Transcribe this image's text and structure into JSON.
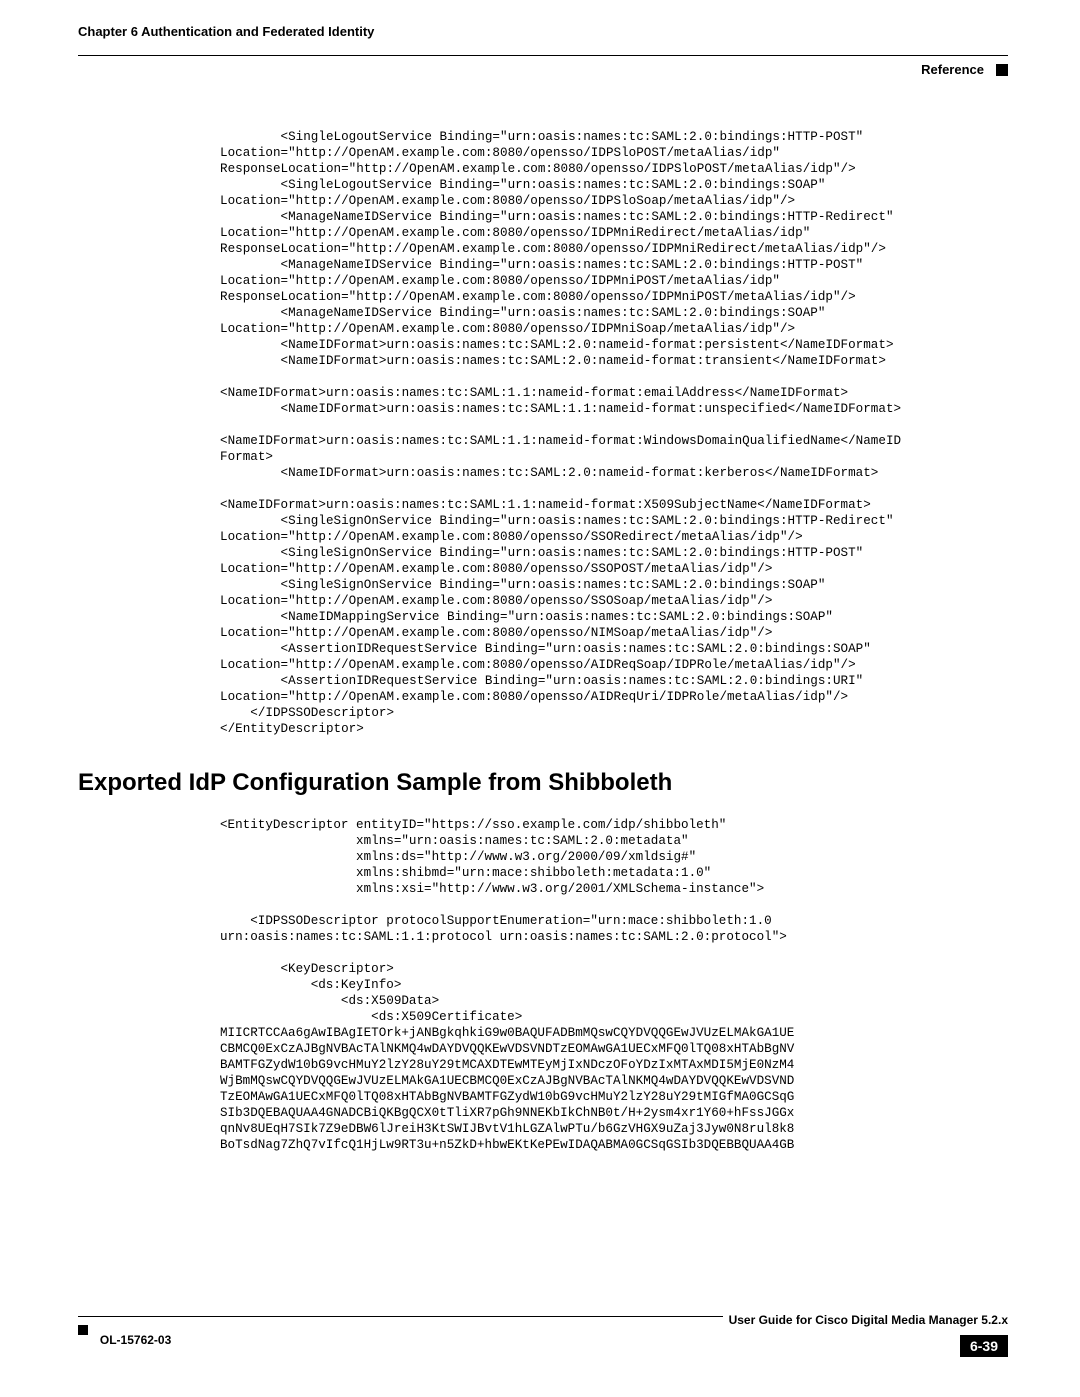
{
  "header": {
    "chapter": "Chapter 6    Authentication and Federated Identity",
    "reference": "Reference"
  },
  "code_block_1": "        <SingleLogoutService Binding=\"urn:oasis:names:tc:SAML:2.0:bindings:HTTP-POST\" \nLocation=\"http://OpenAM.example.com:8080/opensso/IDPSloPOST/metaAlias/idp\" \nResponseLocation=\"http://OpenAM.example.com:8080/opensso/IDPSloPOST/metaAlias/idp\"/>\n        <SingleLogoutService Binding=\"urn:oasis:names:tc:SAML:2.0:bindings:SOAP\" \nLocation=\"http://OpenAM.example.com:8080/opensso/IDPSloSoap/metaAlias/idp\"/>\n        <ManageNameIDService Binding=\"urn:oasis:names:tc:SAML:2.0:bindings:HTTP-Redirect\" \nLocation=\"http://OpenAM.example.com:8080/opensso/IDPMniRedirect/metaAlias/idp\" \nResponseLocation=\"http://OpenAM.example.com:8080/opensso/IDPMniRedirect/metaAlias/idp\"/>\n        <ManageNameIDService Binding=\"urn:oasis:names:tc:SAML:2.0:bindings:HTTP-POST\" \nLocation=\"http://OpenAM.example.com:8080/opensso/IDPMniPOST/metaAlias/idp\" \nResponseLocation=\"http://OpenAM.example.com:8080/opensso/IDPMniPOST/metaAlias/idp\"/>\n        <ManageNameIDService Binding=\"urn:oasis:names:tc:SAML:2.0:bindings:SOAP\" \nLocation=\"http://OpenAM.example.com:8080/opensso/IDPMniSoap/metaAlias/idp\"/>\n        <NameIDFormat>urn:oasis:names:tc:SAML:2.0:nameid-format:persistent</NameIDFormat>\n        <NameIDFormat>urn:oasis:names:tc:SAML:2.0:nameid-format:transient</NameIDFormat>\n        \n<NameIDFormat>urn:oasis:names:tc:SAML:1.1:nameid-format:emailAddress</NameIDFormat>\n        <NameIDFormat>urn:oasis:names:tc:SAML:1.1:nameid-format:unspecified</NameIDFormat>\n        \n<NameIDFormat>urn:oasis:names:tc:SAML:1.1:nameid-format:WindowsDomainQualifiedName</NameID\nFormat>\n        <NameIDFormat>urn:oasis:names:tc:SAML:2.0:nameid-format:kerberos</NameIDFormat>\n        \n<NameIDFormat>urn:oasis:names:tc:SAML:1.1:nameid-format:X509SubjectName</NameIDFormat>\n        <SingleSignOnService Binding=\"urn:oasis:names:tc:SAML:2.0:bindings:HTTP-Redirect\" \nLocation=\"http://OpenAM.example.com:8080/opensso/SSORedirect/metaAlias/idp\"/>\n        <SingleSignOnService Binding=\"urn:oasis:names:tc:SAML:2.0:bindings:HTTP-POST\" \nLocation=\"http://OpenAM.example.com:8080/opensso/SSOPOST/metaAlias/idp\"/>\n        <SingleSignOnService Binding=\"urn:oasis:names:tc:SAML:2.0:bindings:SOAP\" \nLocation=\"http://OpenAM.example.com:8080/opensso/SSOSoap/metaAlias/idp\"/>\n        <NameIDMappingService Binding=\"urn:oasis:names:tc:SAML:2.0:bindings:SOAP\" \nLocation=\"http://OpenAM.example.com:8080/opensso/NIMSoap/metaAlias/idp\"/>\n        <AssertionIDRequestService Binding=\"urn:oasis:names:tc:SAML:2.0:bindings:SOAP\" \nLocation=\"http://OpenAM.example.com:8080/opensso/AIDReqSoap/IDPRole/metaAlias/idp\"/>\n        <AssertionIDRequestService Binding=\"urn:oasis:names:tc:SAML:2.0:bindings:URI\" \nLocation=\"http://OpenAM.example.com:8080/opensso/AIDReqUri/IDPRole/metaAlias/idp\"/>\n    </IDPSSODescriptor>\n</EntityDescriptor>",
  "section_heading": "Exported IdP Configuration Sample from Shibboleth",
  "code_block_2": "<EntityDescriptor entityID=\"https://sso.example.com/idp/shibboleth\" \n                  xmlns=\"urn:oasis:names:tc:SAML:2.0:metadata\"\n                  xmlns:ds=\"http://www.w3.org/2000/09/xmldsig#\"\n                  xmlns:shibmd=\"urn:mace:shibboleth:metadata:1.0\"\n                  xmlns:xsi=\"http://www.w3.org/2001/XMLSchema-instance\">\n\n    <IDPSSODescriptor protocolSupportEnumeration=\"urn:mace:shibboleth:1.0 \nurn:oasis:names:tc:SAML:1.1:protocol urn:oasis:names:tc:SAML:2.0:protocol\">\n\n        <KeyDescriptor>\n            <ds:KeyInfo>\n                <ds:X509Data>\n                    <ds:X509Certificate>\nMIICRTCCAa6gAwIBAgIETOrk+jANBgkqhkiG9w0BAQUFADBmMQswCQYDVQQGEwJVUzELMAkGA1UE\nCBMCQ0ExCzAJBgNVBAcTAlNKMQ4wDAYDVQQKEwVDSVNDTzEOMAwGA1UECxMFQ0lTQ08xHTAbBgNV\nBAMTFGZydW10bG9vcHMuY2lzY28uY29tMCAXDTEwMTEyMjIxNDczOFoYDzIxMTAxMDI5MjE0NzM4\nWjBmMQswCQYDVQQGEwJVUzELMAkGA1UECBMCQ0ExCzAJBgNVBAcTAlNKMQ4wDAYDVQQKEwVDSVND\nTzEOMAwGA1UECxMFQ0lTQ08xHTAbBgNVBAMTFGZydW10bG9vcHMuY2lzY28uY29tMIGfMA0GCSqG\nSIb3DQEBAQUAA4GNADCBiQKBgQCX0tTliXR7pGh9NNEKbIkChNB0t/H+2ysm4xr1Y60+hFssJGGx\nqnNv8UEqH7SIk7Z9eDBW6lJreiH3KtSWIJBvtV1hLGZAlwPTu/b6GzVHGX9uZaj3Jyw0N8rul8k8\nBoTsdNag7ZhQ7vIfcQ1HjLw9RT3u+n5ZkD+hbwEKtKePEwIDAQABMA0GCSqGSIb3DQEBBQUAA4GB",
  "footer": {
    "left": "OL-15762-03",
    "title": "User Guide for Cisco Digital Media Manager 5.2.x",
    "page": "6-39"
  }
}
